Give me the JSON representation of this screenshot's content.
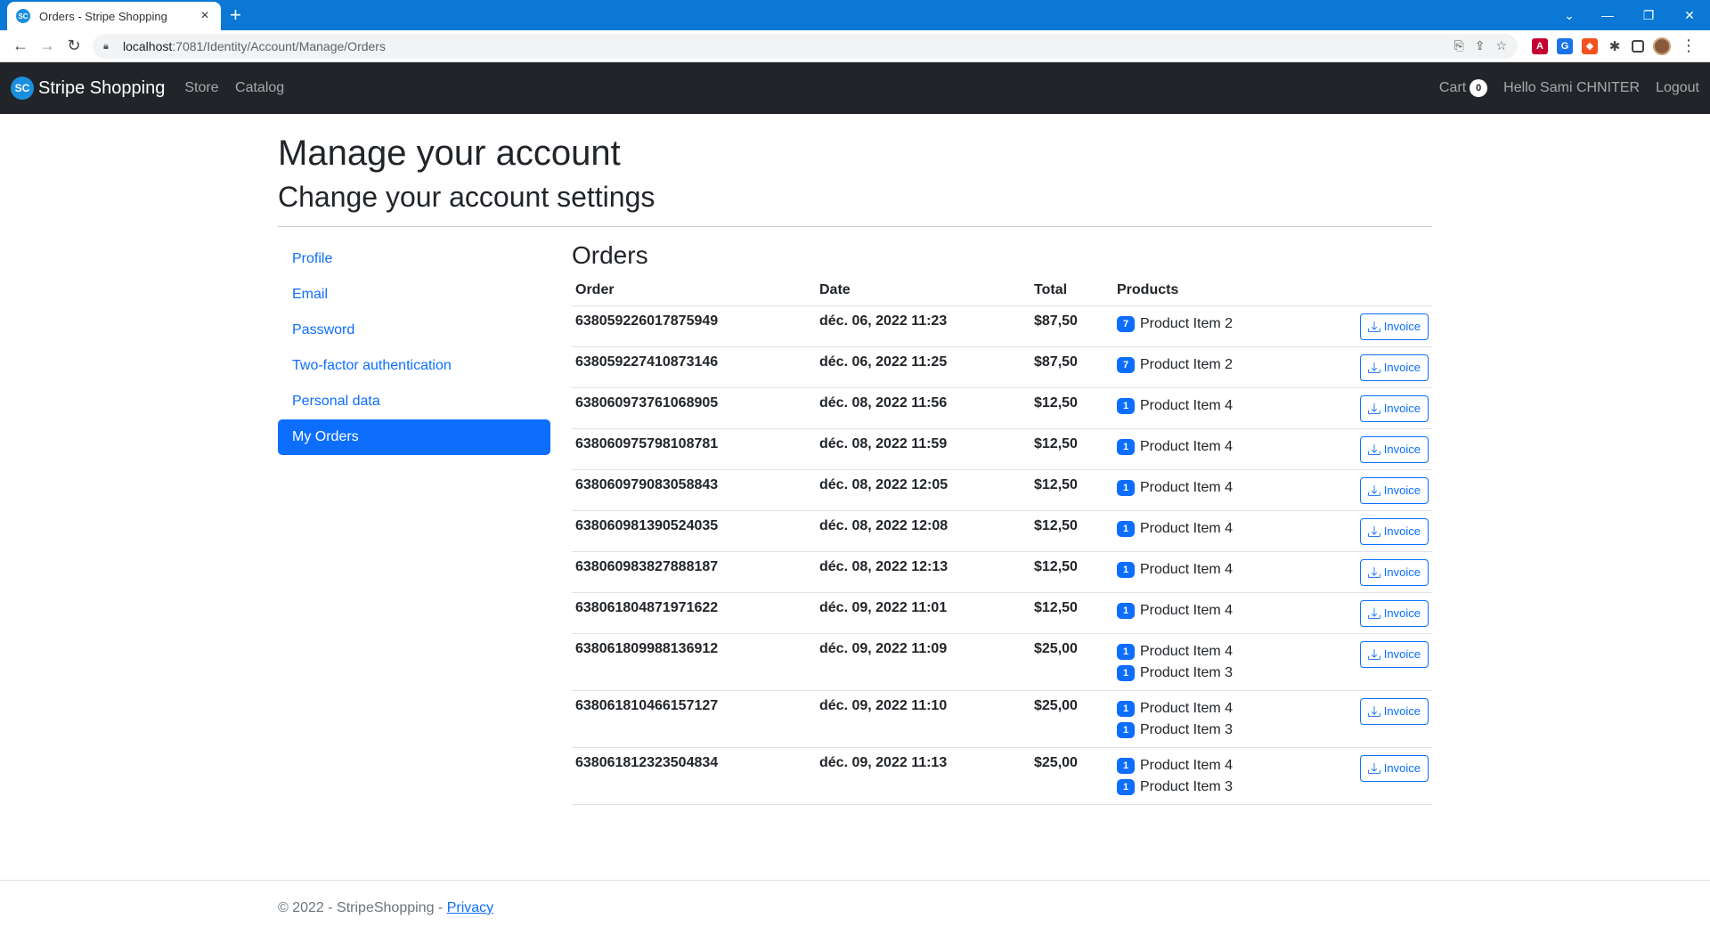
{
  "browser": {
    "tab_title": "Orders - Stripe Shopping",
    "tab_icon_text": "SC",
    "url_host": "localhost",
    "url_path": ":7081/Identity/Account/Manage/Orders"
  },
  "navbar": {
    "brand": "Stripe Shopping",
    "brand_logo_text": "SC",
    "links": [
      "Store",
      "Catalog"
    ],
    "cart_label": "Cart",
    "cart_count": "0",
    "greeting": "Hello Sami CHNITER",
    "logout": "Logout"
  },
  "page": {
    "title": "Manage your account",
    "subtitle": "Change your account settings"
  },
  "sidebar": {
    "items": [
      {
        "label": "Profile",
        "active": false
      },
      {
        "label": "Email",
        "active": false
      },
      {
        "label": "Password",
        "active": false
      },
      {
        "label": "Two-factor authentication",
        "active": false
      },
      {
        "label": "Personal data",
        "active": false
      },
      {
        "label": "My Orders",
        "active": true
      }
    ]
  },
  "orders": {
    "heading": "Orders",
    "columns": [
      "Order",
      "Date",
      "Total",
      "Products"
    ],
    "invoice_label": "Invoice",
    "rows": [
      {
        "order": "638059226017875949",
        "date": "déc. 06, 2022 11:23",
        "total": "$87,50",
        "products": [
          {
            "qty": "7",
            "name": "Product Item 2"
          }
        ]
      },
      {
        "order": "638059227410873146",
        "date": "déc. 06, 2022 11:25",
        "total": "$87,50",
        "products": [
          {
            "qty": "7",
            "name": "Product Item 2"
          }
        ]
      },
      {
        "order": "638060973761068905",
        "date": "déc. 08, 2022 11:56",
        "total": "$12,50",
        "products": [
          {
            "qty": "1",
            "name": "Product Item 4"
          }
        ]
      },
      {
        "order": "638060975798108781",
        "date": "déc. 08, 2022 11:59",
        "total": "$12,50",
        "products": [
          {
            "qty": "1",
            "name": "Product Item 4"
          }
        ]
      },
      {
        "order": "638060979083058843",
        "date": "déc. 08, 2022 12:05",
        "total": "$12,50",
        "products": [
          {
            "qty": "1",
            "name": "Product Item 4"
          }
        ]
      },
      {
        "order": "638060981390524035",
        "date": "déc. 08, 2022 12:08",
        "total": "$12,50",
        "products": [
          {
            "qty": "1",
            "name": "Product Item 4"
          }
        ]
      },
      {
        "order": "638060983827888187",
        "date": "déc. 08, 2022 12:13",
        "total": "$12,50",
        "products": [
          {
            "qty": "1",
            "name": "Product Item 4"
          }
        ]
      },
      {
        "order": "638061804871971622",
        "date": "déc. 09, 2022 11:01",
        "total": "$12,50",
        "products": [
          {
            "qty": "1",
            "name": "Product Item 4"
          }
        ]
      },
      {
        "order": "638061809988136912",
        "date": "déc. 09, 2022 11:09",
        "total": "$25,00",
        "products": [
          {
            "qty": "1",
            "name": "Product Item 4"
          },
          {
            "qty": "1",
            "name": "Product Item 3"
          }
        ]
      },
      {
        "order": "638061810466157127",
        "date": "déc. 09, 2022 11:10",
        "total": "$25,00",
        "products": [
          {
            "qty": "1",
            "name": "Product Item 4"
          },
          {
            "qty": "1",
            "name": "Product Item 3"
          }
        ]
      },
      {
        "order": "638061812323504834",
        "date": "déc. 09, 2022 11:13",
        "total": "$25,00",
        "products": [
          {
            "qty": "1",
            "name": "Product Item 4"
          },
          {
            "qty": "1",
            "name": "Product Item 3"
          }
        ]
      }
    ]
  },
  "footer": {
    "text": "© 2022 - StripeShopping - ",
    "privacy": "Privacy"
  },
  "colors": {
    "browser_accent": "#0a78d4",
    "navbar_bg": "#212529",
    "primary": "#0d6efd"
  }
}
